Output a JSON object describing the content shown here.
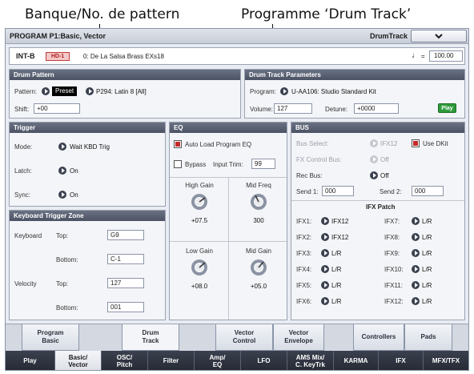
{
  "callouts": {
    "left": "Banque/No. de pattern",
    "right": "Programme ‘Drum Track’"
  },
  "titlebar": {
    "title": "PROGRAM P1:Basic, Vector",
    "mode": "DrumTrack"
  },
  "program": {
    "bank": "INT-B",
    "hd_badge": "HD-1",
    "name": "0: De La Salsa Brass EXs18",
    "tempo_symbol": "♩",
    "tempo_eq": "=",
    "tempo": "100.00"
  },
  "drum_pattern": {
    "header": "Drum Pattern",
    "pattern_label": "Pattern:",
    "pattern_source": "Preset",
    "pattern_value": "P294: Latin 8 [All]",
    "shift_label": "Shift:",
    "shift_value": "+00"
  },
  "drum_track_params": {
    "header": "Drum Track Parameters",
    "program_label": "Program:",
    "program_value": "U-AA106: Studio Standard Kit",
    "volume_label": "Volume:",
    "volume_value": "127",
    "detune_label": "Detune:",
    "detune_value": "+0000",
    "play_label": "Play"
  },
  "trigger": {
    "header": "Trigger",
    "mode_label": "Mode:",
    "mode_value": "Wait KBD Trig",
    "latch_label": "Latch:",
    "latch_value": "On",
    "sync_label": "Sync:",
    "sync_value": "On"
  },
  "keyboard_trigger_zone": {
    "header": "Keyboard Trigger Zone",
    "keyboard_label": "Keyboard",
    "top_label": "Top:",
    "keyboard_top": "G9",
    "bottom_label": "Bottom:",
    "keyboard_bottom": "C-1",
    "velocity_label": "Velocity",
    "velocity_top": "127",
    "velocity_bottom": "001"
  },
  "eq": {
    "header": "EQ",
    "auto_load_label": "Auto Load Program EQ",
    "auto_load_checked": true,
    "bypass_label": "Bypass",
    "bypass_checked": false,
    "input_trim_label": "Input Trim:",
    "input_trim_value": "99",
    "high_gain_label": "High Gain",
    "high_gain_value": "+07.5",
    "mid_freq_label": "Mid Freq",
    "mid_freq_value": "300",
    "low_gain_label": "Low Gain",
    "low_gain_value": "+08.0",
    "mid_gain_label": "Mid Gain",
    "mid_gain_value": "+05.0"
  },
  "bus": {
    "header": "BUS",
    "bus_select_label": "Bus Select:",
    "bus_select_value": "IFX12",
    "use_dkit_label": "Use DKit",
    "use_dkit_checked": true,
    "fx_control_label": "FX Control Bus:",
    "fx_control_value": "Off",
    "rec_bus_label": "Rec Bus:",
    "rec_bus_value": "Off",
    "send1_label": "Send 1:",
    "send1_value": "000",
    "send2_label": "Send 2:",
    "send2_value": "000",
    "ifx_patch_title": "IFX Patch",
    "ifx_left": [
      {
        "label": "IFX1:",
        "value": "IFX12"
      },
      {
        "label": "IFX2:",
        "value": "IFX12"
      },
      {
        "label": "IFX3:",
        "value": "L/R"
      },
      {
        "label": "IFX4:",
        "value": "L/R"
      },
      {
        "label": "IFX5:",
        "value": "L/R"
      },
      {
        "label": "IFX6:",
        "value": "L/R"
      }
    ],
    "ifx_right": [
      {
        "label": "IFX7:",
        "value": "L/R"
      },
      {
        "label": "IFX8:",
        "value": "L/R"
      },
      {
        "label": "IFX9:",
        "value": "L/R"
      },
      {
        "label": "IFX10:",
        "value": "L/R"
      },
      {
        "label": "IFX11:",
        "value": "L/R"
      },
      {
        "label": "IFX12:",
        "value": "L/R"
      }
    ]
  },
  "upper_tabs": [
    {
      "line1": "Program",
      "line2": "Basic"
    },
    {
      "line1": "Drum",
      "line2": "Track"
    },
    {
      "line1": "Vector",
      "line2": "Control"
    },
    {
      "line1": "Vector",
      "line2": "Envelope"
    },
    {
      "line1": "Controllers",
      "line2": ""
    },
    {
      "line1": "Pads",
      "line2": ""
    }
  ],
  "bottom_tabs": [
    {
      "line1": "Play",
      "line2": ""
    },
    {
      "line1": "Basic/",
      "line2": "Vector"
    },
    {
      "line1": "OSC/",
      "line2": "Pitch"
    },
    {
      "line1": "Filter",
      "line2": ""
    },
    {
      "line1": "Amp/",
      "line2": "EQ"
    },
    {
      "line1": "LFO",
      "line2": ""
    },
    {
      "line1": "AMS Mix/",
      "line2": "C. KeyTrk"
    },
    {
      "line1": "KARMA",
      "line2": ""
    },
    {
      "line1": "IFX",
      "line2": ""
    },
    {
      "line1": "MFX/TFX",
      "line2": ""
    }
  ],
  "colors": {
    "header_bg": "#4c5364",
    "screen_bg": "#e9ecf2",
    "check_red": "#c62a2a",
    "play_green": "#2e9a3a",
    "badge_red": "#c43a3a"
  }
}
